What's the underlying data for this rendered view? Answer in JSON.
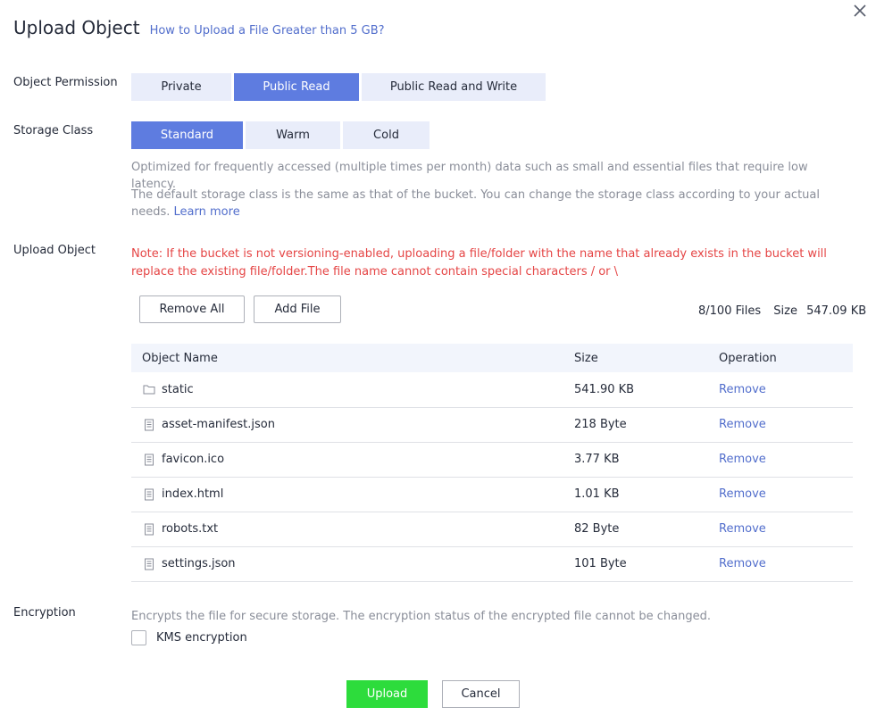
{
  "dialog": {
    "title": "Upload Object",
    "help_link": "How to Upload a File Greater than 5 GB?",
    "close_icon": "close-icon"
  },
  "permission": {
    "label": "Object Permission",
    "options": [
      "Private",
      "Public Read",
      "Public Read and Write"
    ],
    "selected": "Public Read"
  },
  "storage": {
    "label": "Storage Class",
    "options": [
      "Standard",
      "Warm",
      "Cold"
    ],
    "selected": "Standard",
    "description": "Optimized for frequently accessed (multiple times per month) data such as small and essential files that require low latency.",
    "note": "The default storage class is the same as that of the bucket. You can change the storage class according to your actual needs.",
    "learn_more": "Learn more"
  },
  "upload": {
    "label": "Upload Object",
    "note": "Note: If the bucket is not versioning-enabled, uploading a file/folder with the name that already exists in the bucket will replace the existing file/folder.The file name cannot contain special characters / or \\",
    "remove_all": "Remove All",
    "add_file": "Add File",
    "file_count": "8/100 Files",
    "size_label": "Size",
    "size_value": "547.09 KB"
  },
  "table": {
    "columns": [
      "Object Name",
      "Size",
      "Operation"
    ],
    "rows": [
      {
        "name": "static",
        "type": "folder",
        "size": "541.90 KB",
        "operation": "Remove"
      },
      {
        "name": "asset-manifest.json",
        "type": "file",
        "size": "218 Byte",
        "operation": "Remove"
      },
      {
        "name": "favicon.ico",
        "type": "file",
        "size": "3.77 KB",
        "operation": "Remove"
      },
      {
        "name": "index.html",
        "type": "file",
        "size": "1.01 KB",
        "operation": "Remove"
      },
      {
        "name": "robots.txt",
        "type": "file",
        "size": "82 Byte",
        "operation": "Remove"
      },
      {
        "name": "settings.json",
        "type": "file",
        "size": "101 Byte",
        "operation": "Remove"
      }
    ]
  },
  "encryption": {
    "label": "Encryption",
    "description": "Encrypts the file for secure storage. The encryption status of the encrypted file cannot be changed.",
    "kms_label": "KMS encryption",
    "kms_checked": false
  },
  "footer": {
    "upload": "Upload",
    "cancel": "Cancel"
  },
  "colors": {
    "accent": "#5e7ce0",
    "link": "#526ecc",
    "upload_button": "#2ddc3c",
    "warning": "#e54545"
  }
}
